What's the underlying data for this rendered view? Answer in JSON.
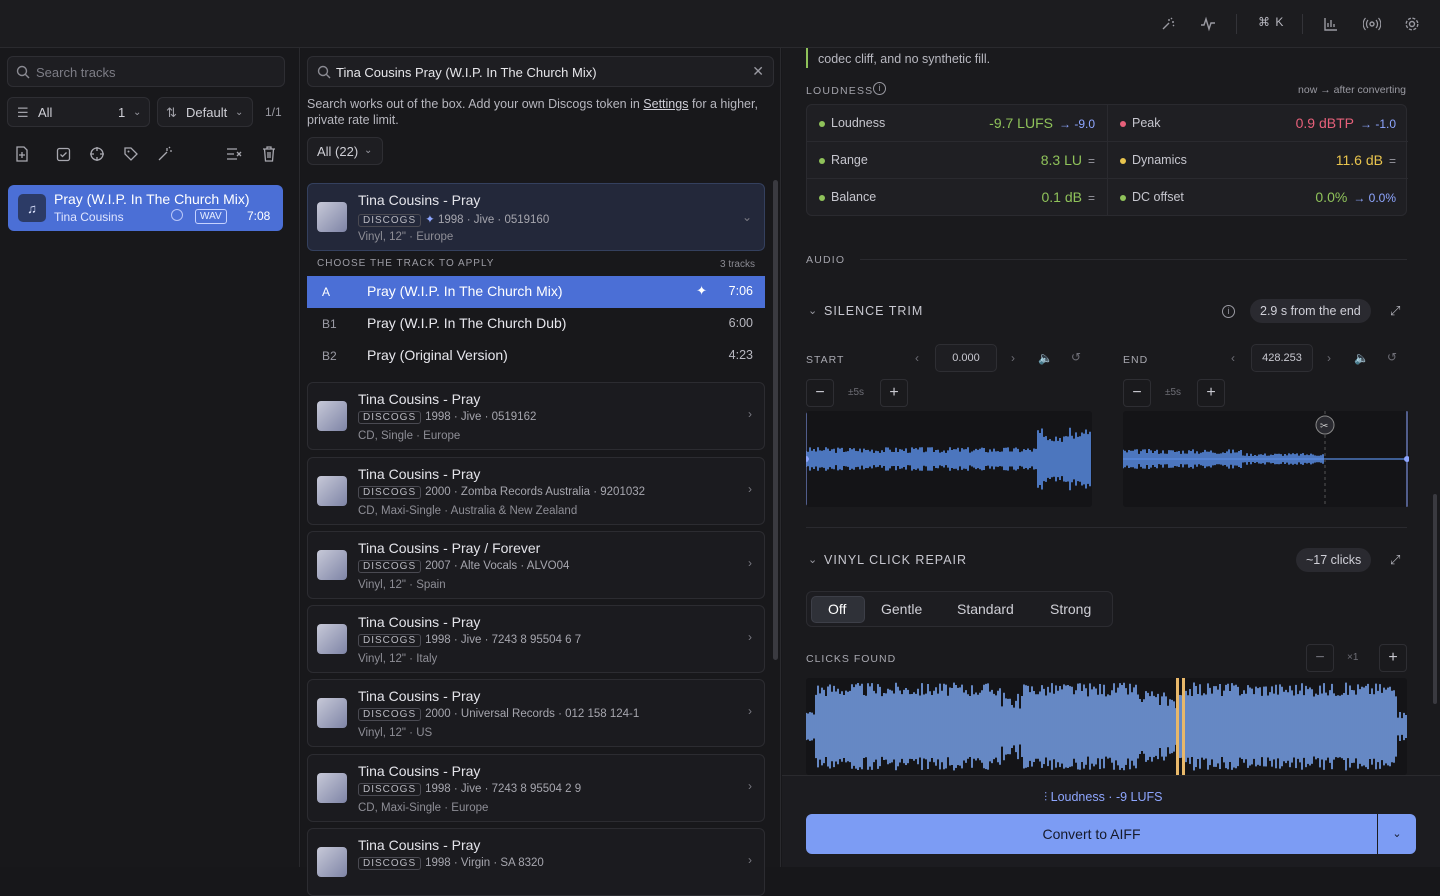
{
  "topbar": {
    "shortcut": "⌘ K"
  },
  "left": {
    "search_placeholder": "Search tracks",
    "filter": "All",
    "count_filter": "1",
    "sort": "Default",
    "pagination": "1/1",
    "track": {
      "title": "Pray (W.I.P. In The Church Mix)",
      "artist": "Tina Cousins",
      "format": "WAV",
      "duration": "7:08"
    }
  },
  "mid": {
    "search_value": "Tina Cousins Pray (W.I.P. In The Church Mix)",
    "help_pre": "Search works out of the box. Add your own Discogs token in ",
    "help_link": "Settings",
    "help_post": " for a higher, private rate limit.",
    "filter": "All (22)",
    "discogs_label": "DISCOGS",
    "choose_label": "CHOOSE THE TRACK TO APPLY",
    "choose_count": "3 tracks",
    "expanded": {
      "title": "Tina Cousins - Pray",
      "meta": "1998 · Jive · 0519160",
      "sub": "Vinyl, 12\" · Europe"
    },
    "tracks": [
      {
        "pos": "A",
        "name": "Pray (W.I.P. In The Church Mix)",
        "dur": "7:06"
      },
      {
        "pos": "B1",
        "name": "Pray (W.I.P. In The Church Dub)",
        "dur": "6:00"
      },
      {
        "pos": "B2",
        "name": "Pray (Original Version)",
        "dur": "4:23"
      }
    ],
    "results": [
      {
        "title": "Tina Cousins - Pray",
        "meta": "1998 · Jive · 0519162",
        "sub": "CD, Single · Europe"
      },
      {
        "title": "Tina Cousins - Pray",
        "meta": "2000 · Zomba Records Australia · 9201032",
        "sub": "CD, Maxi-Single · Australia & New Zealand"
      },
      {
        "title": "Tina Cousins - Pray / Forever",
        "meta": "2007 · Alte Vocals · ALVO04",
        "sub": "Vinyl, 12\" · Spain"
      },
      {
        "title": "Tina Cousins - Pray",
        "meta": "1998 · Jive · 7243 8 95504 6 7",
        "sub": "Vinyl, 12\" · Italy"
      },
      {
        "title": "Tina Cousins - Pray",
        "meta": "2000 · Universal Records · 012 158 124-1",
        "sub": "Vinyl, 12\" · US"
      },
      {
        "title": "Tina Cousins - Pray",
        "meta": "1998 · Jive · 7243 8 95504 2 9",
        "sub": "CD, Maxi-Single · Europe"
      },
      {
        "title": "Tina Cousins - Pray",
        "meta": "1998 · Virgin · SA 8320",
        "sub": ""
      }
    ]
  },
  "right": {
    "codec_note": "codec cliff, and no synthetic fill.",
    "loudness_label": "LOUDNESS",
    "now_after": "now → after converting",
    "metrics": [
      {
        "label": "Loudness",
        "value": "-9.7 LUFS",
        "after": "→ -9.0",
        "color": "#8fc25a"
      },
      {
        "label": "Peak",
        "value": "0.9 dBTP",
        "after": "→ -1.0",
        "color": "#e6607a"
      },
      {
        "label": "Range",
        "value": "8.3 LU",
        "after": "=",
        "color": "#8fc25a"
      },
      {
        "label": "Dynamics",
        "value": "11.6 dB",
        "after": "=",
        "color": "#e8c44e"
      },
      {
        "label": "Balance",
        "value": "0.1 dB",
        "after": "=",
        "color": "#8fc25a"
      },
      {
        "label": "DC offset",
        "value": "0.0%",
        "after": "→ 0.0%",
        "color": "#8fc25a"
      }
    ],
    "audio_label": "AUDIO",
    "silence": {
      "title": "SILENCE TRIM",
      "pill": "2.9 s from the end",
      "start_label": "START",
      "end_label": "END",
      "start_value": "0.000",
      "end_value": "428.253",
      "step": "±5s"
    },
    "vinyl": {
      "title": "VINYL CLICK REPAIR",
      "pill": "~17 clicks",
      "options": [
        "Off",
        "Gentle",
        "Standard",
        "Strong"
      ],
      "selected": "Off",
      "clicks_label": "CLICKS FOUND",
      "zoom": "×1"
    },
    "bottom": {
      "lufs_line": "Loudness · -9 LUFS",
      "convert": "Convert to AIFF"
    }
  }
}
